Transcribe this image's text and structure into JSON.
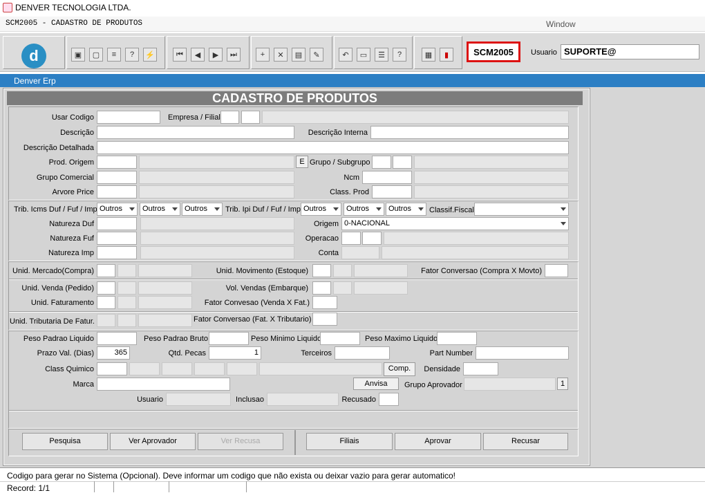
{
  "window": {
    "title": "DENVER TECNOLOGIA LTDA."
  },
  "menu": {
    "form": "SCM2005 - CADASTRO DE PRODUTOS",
    "window": "Window"
  },
  "toolbar": {
    "logo": "d",
    "code": "SCM2005",
    "user_label": "Usuario",
    "user_value": "SUPORTE@",
    "icons": [
      "save-icon",
      "print-preview-icon",
      "print-icon",
      "help-query-icon",
      "execute-query-icon",
      "first-record-icon",
      "prev-record-icon",
      "next-record-icon",
      "last-record-icon",
      "insert-record-icon",
      "delete-record-icon",
      "form-icon",
      "edit-icon",
      "undo-icon",
      "clipboard-icon",
      "list-icon",
      "help-icon",
      "menu-icon",
      "exit-icon"
    ]
  },
  "tab": {
    "label": "Denver Erp"
  },
  "form": {
    "title": "CADASTRO DE PRODUTOS",
    "labels": {
      "usar_codigo": "Usar Codigo",
      "empresa": "Empresa / Filial",
      "descricao": "Descrição",
      "desc_interna": "Descrição Interna",
      "desc_det": "Descrição Detalhada",
      "prod_origem": "Prod. Origem",
      "e": "E",
      "grupo": "Grupo / Subgrupo",
      "grupo_com": "Grupo Comercial",
      "ncm": "Ncm",
      "arvore": "Arvore Price",
      "class_prod": "Class. Prod",
      "trib_icms": "Trib. Icms Duf / Fuf / Imp",
      "trib_ipi": "Trib. Ipi  Duf / Fuf / Imp",
      "classif": "Classif.Fiscal",
      "nat_duf": "Natureza Duf",
      "origem": "Origem",
      "nat_fuf": "Natureza Fuf",
      "operacao": "Operacao",
      "nat_imp": "Natureza Imp",
      "conta": "Conta",
      "unid_merc": "Unid. Mercado(Compra)",
      "unid_mov": "Unid. Movimento (Estoque)",
      "fator_conv": "Fator Conversao (Compra X Movto)",
      "unid_venda": "Unid. Venda (Pedido)",
      "vol_vendas": "Vol. Vendas (Embarque)",
      "unid_fat": "Unid. Faturamento",
      "fator_venda": "Fator Convesao (Venda X Fat.)",
      "unid_trib": "Unid. Tributaria De Fatur.",
      "fator_trib": "Fator Conversao (Fat. X Tributario)",
      "peso_liq": "Peso Padrao Liquido",
      "peso_bruto": "Peso Padrao Bruto",
      "peso_min": "Peso Minimo Liquido",
      "peso_max": "Peso Maximo Liquido",
      "prazo": "Prazo Val. (Dias)",
      "qtd_pecas": "Qtd. Pecas",
      "terceiros": "Terceiros",
      "part_number": "Part Number",
      "class_quimico": "Class Quimico",
      "comp": "Comp.",
      "densidade": "Densidade",
      "marca": "Marca",
      "anvisa": "Anvisa",
      "grupo_aprov": "Grupo Aprovador",
      "usuario": "Usuario",
      "inclusao": "Inclusao",
      "recusado": "Recusado"
    },
    "values": {
      "outros": "Outros",
      "origem": "0-NACIONAL",
      "prazo": "365",
      "qtd_pecas": "1",
      "grupo_aprov_n": "1"
    },
    "buttons": {
      "pesquisa": "Pesquisa",
      "ver_aprovador": "Ver Aprovador",
      "ver_recusa": "Ver Recusa",
      "filiais": "Filiais",
      "aprovar": "Aprovar",
      "recusar": "Recusar"
    }
  },
  "status": {
    "hint": "Codigo para gerar no Sistema (Opcional). Deve informar um codigo que não exista ou deixar vazio para gerar automatico!",
    "record": "Record: 1/1"
  }
}
